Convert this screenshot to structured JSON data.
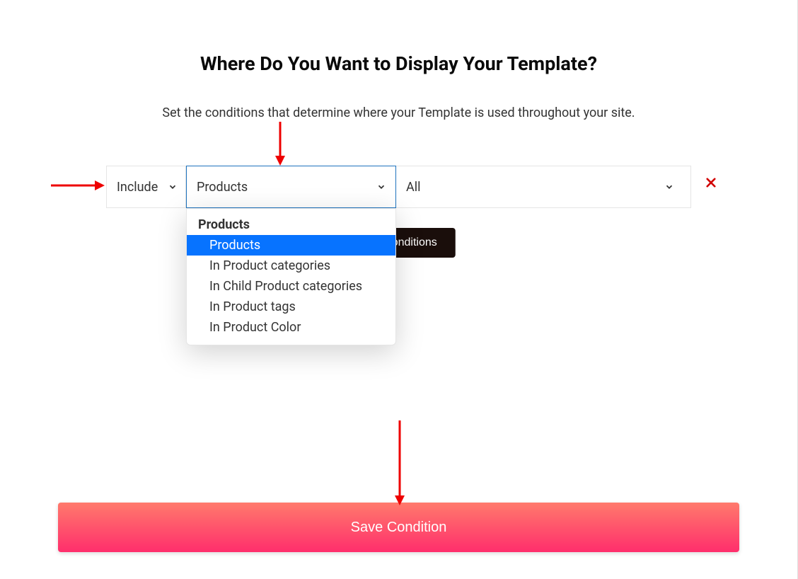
{
  "header": {
    "title": "Where Do You Want to Display Your Template?",
    "subtitle": "Set the conditions that determine where your Template is used throughout your site."
  },
  "condition": {
    "include_label": "Include",
    "products_label": "Products",
    "all_label": "All"
  },
  "dropdown": {
    "group_label": "Products",
    "items": {
      "0": {
        "label": "Products",
        "selected": true
      },
      "1": {
        "label": "In Product categories",
        "selected": false
      },
      "2": {
        "label": "In Child Product categories",
        "selected": false
      },
      "3": {
        "label": "In Product tags",
        "selected": false
      },
      "4": {
        "label": "In Product Color",
        "selected": false
      }
    }
  },
  "buttons": {
    "add_conditions": "Add Conditions",
    "save": "Save Condition"
  },
  "colors": {
    "accent_blue": "#0773ff",
    "danger_red": "#d10000",
    "save_gradient_top": "#ff7a6c",
    "save_gradient_bottom": "#ff2e6c"
  }
}
